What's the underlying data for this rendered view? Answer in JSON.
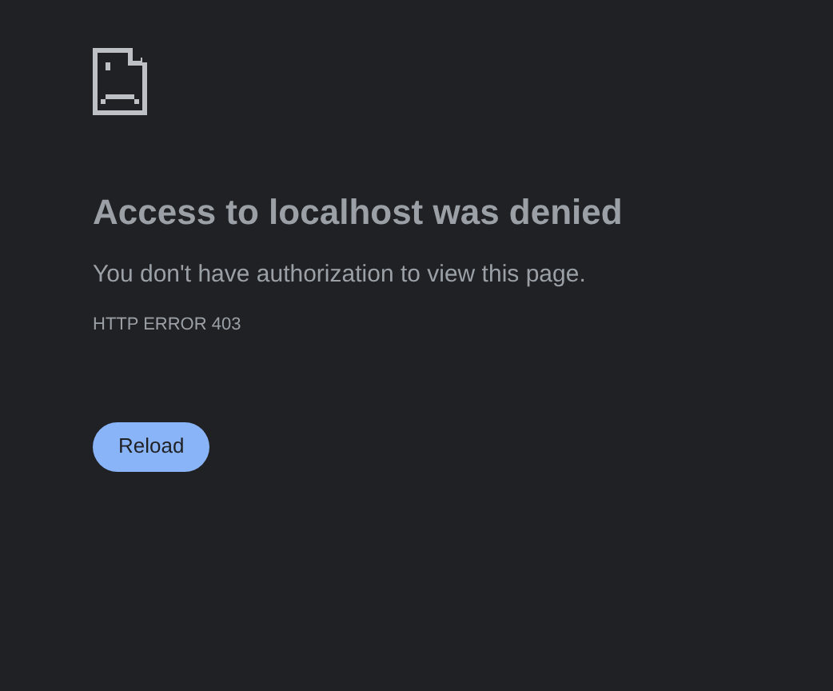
{
  "heading": "Access to localhost was denied",
  "message": "You don't have authorization to view this page.",
  "error_code": "HTTP ERROR 403",
  "buttons": [
    "Reload"
  ]
}
